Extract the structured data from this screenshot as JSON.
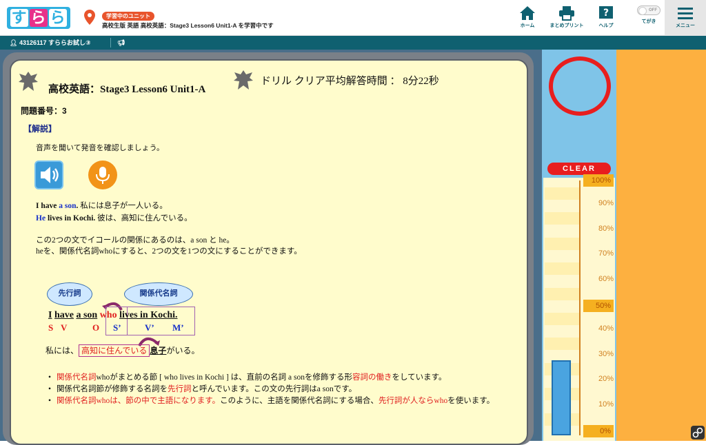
{
  "header": {
    "logo_text": "すらら",
    "badge": "学習中のユニット",
    "unit_status": "高校生版 英語 高校英語：Stage3 Lesson6 Unit1-A を学習中です",
    "nav": [
      {
        "label": "ホーム",
        "icon": "home-icon"
      },
      {
        "label": "まとめプリント",
        "icon": "printer-icon"
      },
      {
        "label": "ヘルプ",
        "icon": "help-icon"
      }
    ],
    "toggle_label": "てがき",
    "toggle_state": "OFF",
    "menu_label": "メニュー"
  },
  "userbar": {
    "user": "43126117 すららお試し③"
  },
  "panel": {
    "title": "高校英語：Stage3 Lesson6 Unit1-A",
    "avg_time": "ドリル クリア平均解答時間 ： 8分22秒",
    "question_no": "問題番号：3",
    "section": "【解説】",
    "instruction": "音声を聞いて発音を確認しましょう。",
    "ex1_en_a": "I have ",
    "ex1_en_b": "a son",
    "ex1_en_c": ". ",
    "ex1_jp": "私には息子が一人いる。",
    "ex2_en_a": "He",
    "ex2_en_b": " lives in Kochi. ",
    "ex2_jp": "彼は、高知に住んでいる。",
    "para1": "この2つの文でイコールの関係にあるのは、a son と he。",
    "para2": "heを、関係代名詞whoにすると、2つの文を1つの文にすることができます。",
    "bubble_antecedent": "先行詞",
    "bubble_relative": "関係代名詞",
    "sentence": {
      "w1": "I",
      "w2": "have",
      "w3": "a son",
      "w4": "who",
      "w5": "lives in Kochi."
    },
    "svo": [
      "S",
      "V",
      "O",
      "S’",
      "V’",
      "M’"
    ],
    "jp_a": "私には、",
    "jp_box": "高知に住んでいる",
    "jp_b": "息子",
    "jp_c": "がいる。",
    "bullets": [
      {
        "parts": [
          {
            "t": "関係代名詞",
            "c": "red"
          },
          {
            "t": "whoがまとめる節 [ who lives in Kochi ] は、直前の名詞 a sonを修飾する形",
            "c": ""
          },
          {
            "t": "容詞の働き",
            "c": "red"
          },
          {
            "t": "をしています。",
            "c": ""
          }
        ]
      },
      {
        "parts": [
          {
            "t": "関係代名詞節が修飾する名詞を",
            "c": ""
          },
          {
            "t": "先行詞",
            "c": "red"
          },
          {
            "t": "と呼んでいます。この文の先行詞はa sonです。",
            "c": ""
          }
        ]
      },
      {
        "parts": [
          {
            "t": "関係代名詞whoは、節の中で主語になります。",
            "c": "red"
          },
          {
            "t": "このように、主語を関係代名詞にする場合、",
            "c": ""
          },
          {
            "t": "先行詞が人ならwho",
            "c": "red"
          },
          {
            "t": "を使います。",
            "c": ""
          }
        ]
      }
    ]
  },
  "side": {
    "clear_label": "CLEAR",
    "scale": [
      "100%",
      "90%",
      "80%",
      "70%",
      "60%",
      "50%",
      "40%",
      "30%",
      "20%",
      "10%",
      "0%"
    ],
    "progress": 0.3
  },
  "colors": {
    "teal": "#0f6070",
    "red": "#e02020",
    "orange": "#fdb040",
    "panel": "#fffccc"
  }
}
